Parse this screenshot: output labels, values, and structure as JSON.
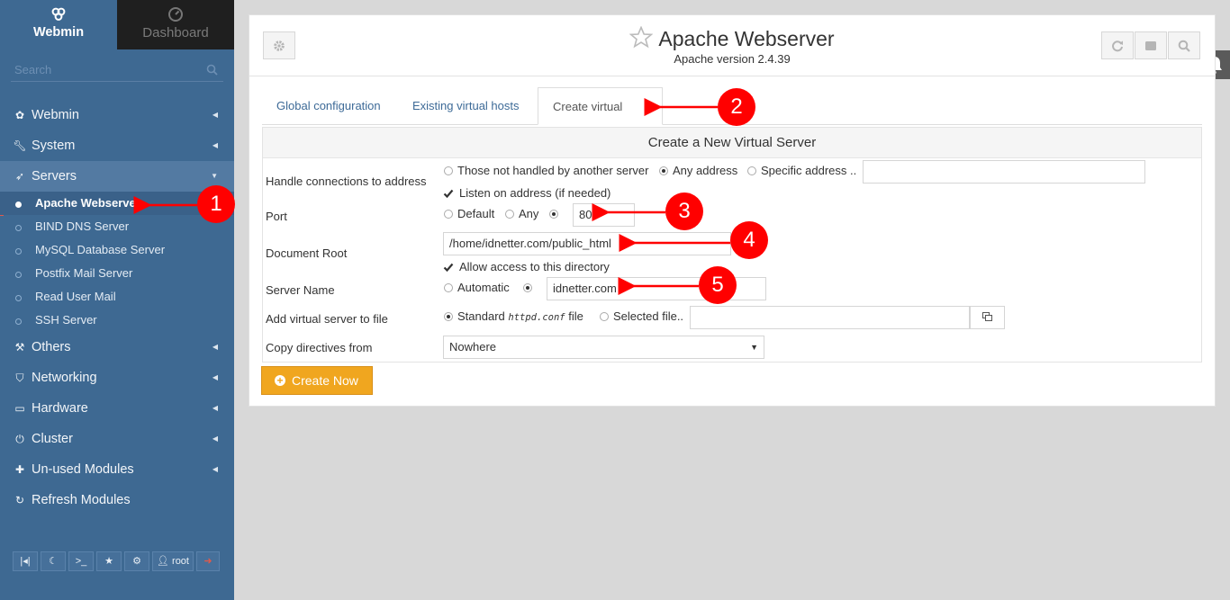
{
  "sidebar": {
    "tabs": {
      "webmin": "Webmin",
      "dashboard": "Dashboard"
    },
    "search_placeholder": "Search",
    "categories": [
      {
        "label": "Webmin",
        "icon": "gear-icon"
      },
      {
        "label": "System",
        "icon": "wrench-icon"
      },
      {
        "label": "Servers",
        "icon": "rocket-icon",
        "expanded": true
      },
      {
        "label": "Others",
        "icon": "hammer-icon"
      },
      {
        "label": "Networking",
        "icon": "shield-icon"
      },
      {
        "label": "Hardware",
        "icon": "drive-icon"
      },
      {
        "label": "Cluster",
        "icon": "power-icon"
      },
      {
        "label": "Un-used Modules",
        "icon": "puzzle-icon"
      },
      {
        "label": "Refresh Modules",
        "icon": "refresh-icon"
      }
    ],
    "server_items": [
      {
        "label": "Apache Webserver",
        "active": true
      },
      {
        "label": "BIND DNS Server"
      },
      {
        "label": "MySQL Database Server"
      },
      {
        "label": "Postfix Mail Server"
      },
      {
        "label": "Read User Mail"
      },
      {
        "label": "SSH Server"
      }
    ],
    "bottom_user": "root"
  },
  "header": {
    "title": "Apache Webserver",
    "subtitle": "Apache version 2.4.39"
  },
  "tabs": [
    "Global configuration",
    "Existing virtual hosts",
    "Create virtual host"
  ],
  "form": {
    "heading": "Create a New Virtual Server",
    "address": {
      "label": "Handle connections to address",
      "options": [
        "Those not handled by another server",
        "Any address",
        "Specific address .."
      ],
      "selected": "Any address",
      "value": "",
      "listen_label": "Listen on address (if needed)",
      "listen_checked": true
    },
    "port": {
      "label": "Port",
      "options": [
        "Default",
        "Any"
      ],
      "value": "80"
    },
    "document_root": {
      "label": "Document Root",
      "value": "/home/idnetter.com/public_html",
      "allow_label": "Allow access to this directory",
      "allow_checked": true
    },
    "server_name": {
      "label": "Server Name",
      "option": "Automatic",
      "value": "idnetter.com"
    },
    "add_to_file": {
      "label": "Add virtual server to file",
      "standard_prefix": "Standard",
      "standard_file": "httpd.conf",
      "standard_suffix": "file",
      "selected_label": "Selected file..",
      "value": ""
    },
    "copy_directives": {
      "label": "Copy directives from",
      "value": "Nowhere"
    },
    "submit_label": "Create Now"
  },
  "annotations": [
    "1",
    "2",
    "3",
    "4",
    "5"
  ],
  "colors": {
    "sidebar": "#3e6992",
    "accent_button": "#f0a61f",
    "annotation": "#ff0000",
    "link": "#3d6a97"
  }
}
